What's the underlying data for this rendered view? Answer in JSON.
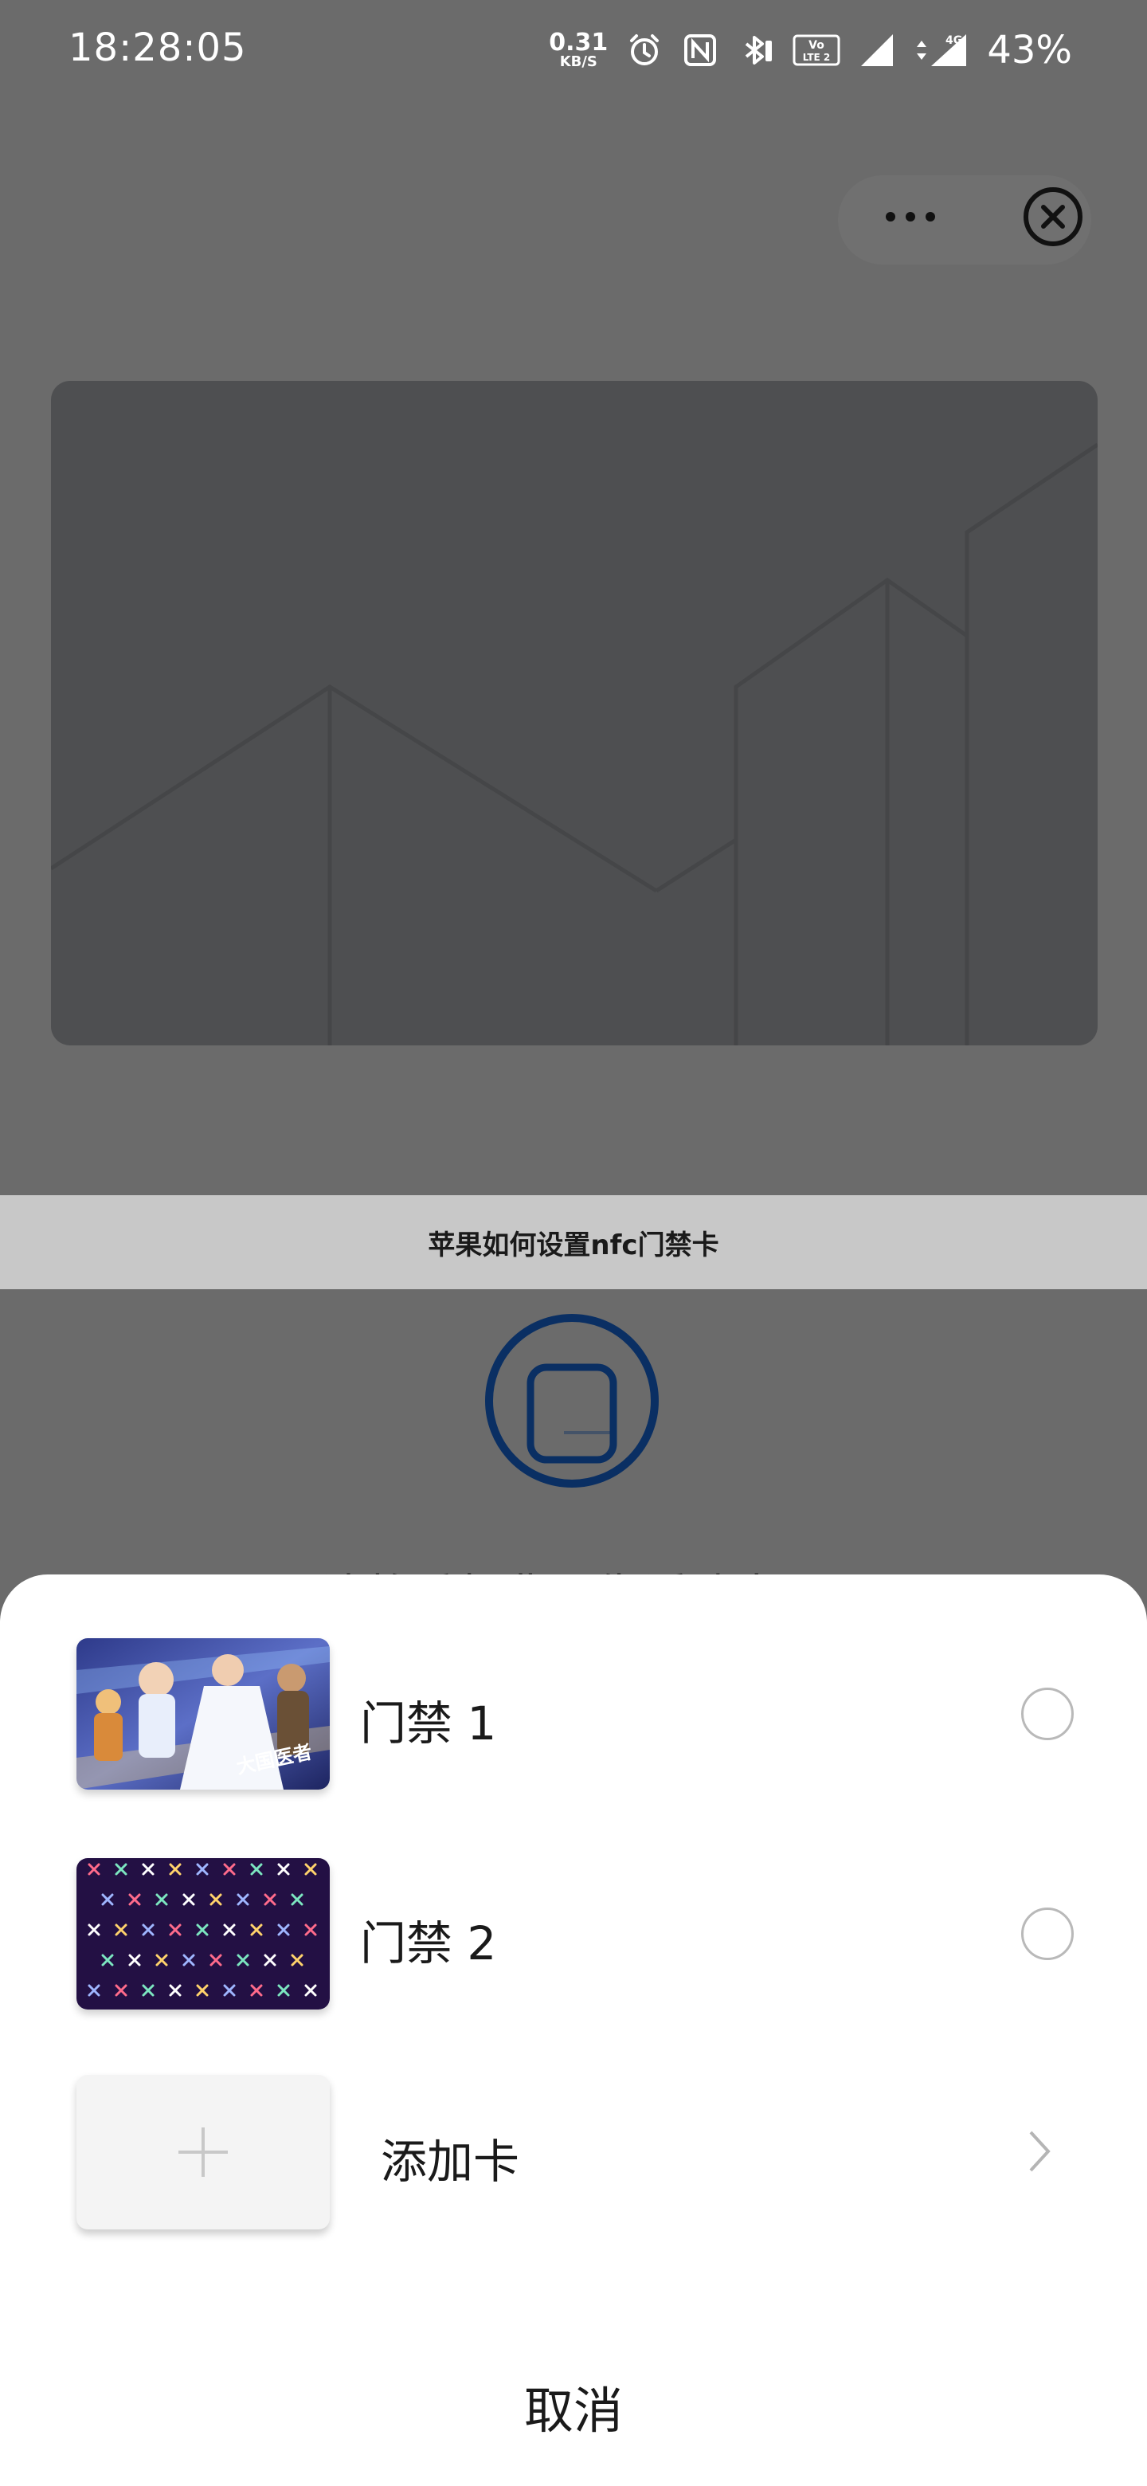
{
  "status_bar": {
    "time": "18:28:05",
    "net_speed_value": "0.31",
    "net_speed_unit": "KB/S",
    "volte_line1": "Vo",
    "volte_line2": "LTE 2",
    "network_type": "4G",
    "battery_percent": "43%",
    "icons": [
      "alarm-icon",
      "nfc-icon",
      "bluetooth-icon",
      "battery-small-icon",
      "volte-icon",
      "signal-icon",
      "signal-4g-icon"
    ]
  },
  "mini_program_capsule": {
    "more_icon": "more-dots-icon",
    "close_icon": "close-circle-icon"
  },
  "caption": "苹果如何设置nfc门禁卡",
  "background_hint_text": "请将手机背面靠近读卡器",
  "card_sheet": {
    "cards": [
      {
        "name": "门禁 1",
        "thumbnail": "illustrated-medical-workers-image",
        "thumbnail_text": "大国医者",
        "selected": false
      },
      {
        "name": "门禁 2",
        "thumbnail": "purple-x-pattern-image",
        "selected": false
      }
    ],
    "add_card": {
      "label": "添加卡",
      "icon": "plus-icon",
      "chevron": "chevron-right-icon"
    },
    "cancel_label": "取消"
  },
  "colors": {
    "overlay": "#6b6b6b",
    "sheet_background": "#ffffff",
    "caption_bar": "#c8c8c8",
    "nfc_ring": "#0a2f63"
  }
}
